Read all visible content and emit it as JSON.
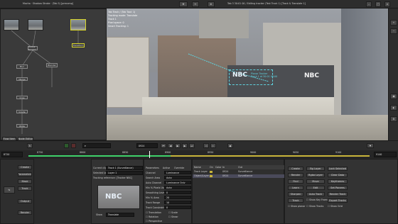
{
  "window": {
    "title": "Mocha · Shadow Stroke · (Tab 5) [precomp]",
    "viewer_title": "Tab 3 30:01 00 / Editing tracker (Test Track 1) [Track & Translate 1]"
  },
  "node_graph": {
    "nodes": [
      "Colour Source",
      "Transform",
      "Blur",
      "Blender",
      "Merge",
      "Crop",
      "Grade",
      "Write"
    ],
    "tabs": [
      "Flow Item",
      "Node Editor"
    ]
  },
  "viewer": {
    "overlay_text": [
      "Tab Track / (Tab Tool: 1)",
      "Tracking mode: Translate",
      "Track 1",
      "Pixel space: 0",
      "Smart Tracking: 1"
    ],
    "tracker_label": [
      "Planar Tracker",
      "Track 1 at 30:01 00:00"
    ],
    "nbc_logo": "NBC"
  },
  "transport": {
    "frame_value": "0924",
    "left_frame": "8720",
    "right_frame": "9140",
    "scale_marks": [
      "8750",
      "8800",
      "8850",
      "8900",
      "8950",
      "9000",
      "9050",
      "9100"
    ]
  },
  "tools": {
    "buttons": [
      "Create",
      "Parameters",
      "Mask",
      "Track",
      "Output",
      "Render"
    ]
  },
  "properties": {
    "current_clip_label": "Current clip",
    "current_clip_value": "Track 1 (Surveillance)",
    "layer_label": "Selected layer",
    "layer_value": "Layer 1",
    "tracking_reference": "Tracking reference: [Tracker NBC]",
    "preview_text": "NBC",
    "show_label": "Show",
    "show_value": "Translate"
  },
  "params": {
    "header": [
      "Parameters",
      "Active",
      "Override"
    ],
    "rows": [
      {
        "label": "Channel",
        "value": "Luminance"
      },
      {
        "label": "Search Area",
        "value": "Auto"
      },
      {
        "label": "Auto Channel",
        "value": "Luminance Only"
      },
      {
        "label": "Min % Pixels Used",
        "value": "Auto"
      },
      {
        "label": "Smoothing Level",
        "value": "0"
      },
      {
        "label": "Min % Area",
        "value": "20"
      },
      {
        "label": "Track Range",
        "value": "10"
      },
      {
        "label": "Track Constraint",
        "value": "0"
      }
    ],
    "checkbox_labels": [
      "Translation",
      "Scale",
      "Rotation",
      "Shear",
      "Perspective"
    ]
  },
  "layers": {
    "columns": [
      "Name",
      "On",
      "Color",
      "In",
      "Out"
    ],
    "rows": [
      {
        "name": "Track Layer",
        "in": "0924",
        "out": "Surveillance"
      },
      {
        "name": "Object/Layer 1",
        "in": "0924",
        "out": "Surveillance"
      }
    ]
  },
  "right_buttons": {
    "col1": [
      "Create",
      "Render",
      "Find",
      "Learn",
      "Sharpen",
      "Track",
      "Show planar"
    ],
    "col2": [
      "Bg Layer",
      "Rgba Layer",
      "Move",
      "Edit",
      "Auto Track",
      "Show Key Frames",
      "Show Tracks"
    ],
    "col3": [
      "Lock Selected",
      "Clear Data",
      "Keyframes",
      "Set Params",
      "Render Track",
      "Export Tracks",
      "Show Grid"
    ]
  },
  "colors": {
    "accent_green": "#3fd16a",
    "timeline_yellow": "#c8b43a",
    "tracker_cyan": "#5fd3e0"
  }
}
